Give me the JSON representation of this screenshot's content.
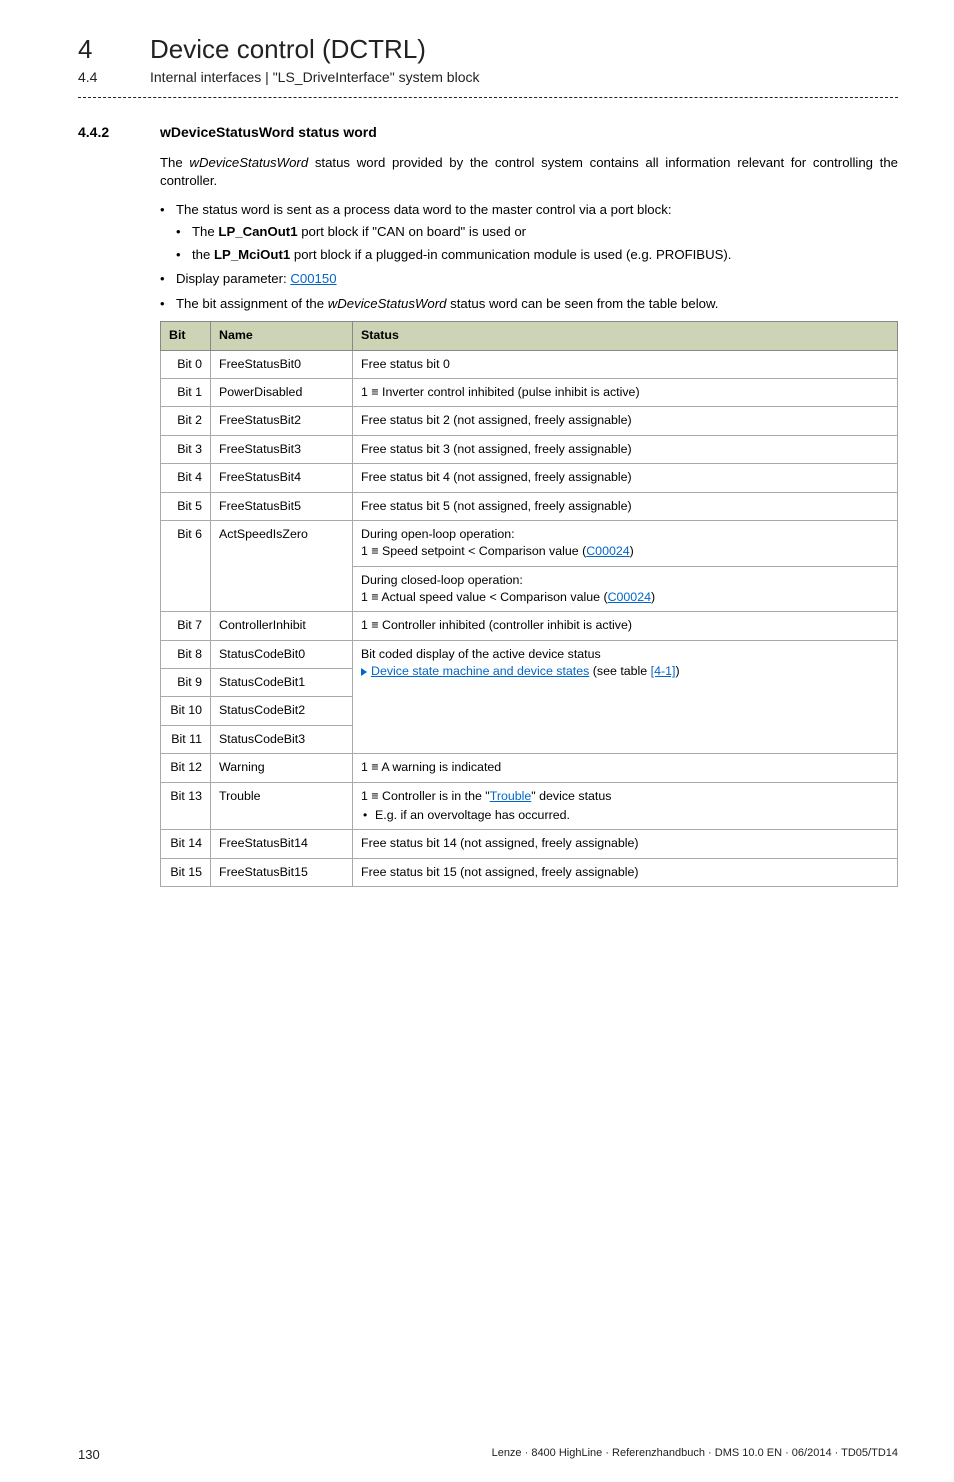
{
  "header": {
    "chapter_num": "4",
    "chapter_title": "Device control (DCTRL)",
    "sub_num": "4.4",
    "sub_title": "Internal interfaces | \"LS_DriveInterface\" system block"
  },
  "section": {
    "num": "4.4.2",
    "title": "wDeviceStatusWord status word"
  },
  "intro_a": "The ",
  "intro_italic1": "wDeviceStatusWord",
  "intro_b": " status word provided by the control system contains all information relevant for controlling the controller.",
  "b1": "The status word is sent as a process data word to the master control via a port block:",
  "b1_1a": "The ",
  "b1_1b": "LP_CanOut1",
  "b1_1c": " port block if \"CAN on board\" is used or",
  "b1_2a": "the ",
  "b1_2b": "LP_MciOut1",
  "b1_2c": " port block if a plugged-in communication module is used (e.g. PROFIBUS).",
  "b2a": "Display parameter: ",
  "b2_link": "C00150",
  "b3a": "The bit assignment of the ",
  "b3_italic": "wDeviceStatusWord",
  "b3b": " status word can be seen from the table below.",
  "th_bit": "Bit",
  "th_name": "Name",
  "th_status": "Status",
  "rows": {
    "r0": {
      "bit": "Bit 0",
      "name": "FreeStatusBit0",
      "status": "Free status bit 0"
    },
    "r1": {
      "bit": "Bit 1",
      "name": "PowerDisabled",
      "status": "1 ≡ Inverter control inhibited (pulse inhibit is active)"
    },
    "r2": {
      "bit": "Bit 2",
      "name": "FreeStatusBit2",
      "status": "Free status bit 2 (not assigned, freely assignable)"
    },
    "r3": {
      "bit": "Bit 3",
      "name": "FreeStatusBit3",
      "status": "Free status bit 3 (not assigned, freely assignable)"
    },
    "r4": {
      "bit": "Bit 4",
      "name": "FreeStatusBit4",
      "status": "Free status bit 4 (not assigned, freely assignable)"
    },
    "r5": {
      "bit": "Bit 5",
      "name": "FreeStatusBit5",
      "status": "Free status bit 5 (not assigned, freely assignable)"
    },
    "r6a": {
      "bit": "Bit 6",
      "name": "ActSpeedIsZero",
      "s1": "During open-loop operation:",
      "s2a": "1 ≡ Speed setpoint < Comparison value (",
      "s2link": "C00024",
      "s2b": ")"
    },
    "r6b": {
      "s1": "During closed-loop operation:",
      "s2a": "1 ≡ Actual speed value < Comparison value (",
      "s2link": "C00024",
      "s2b": ")"
    },
    "r7": {
      "bit": "Bit 7",
      "name": "ControllerInhibit",
      "status": "1 ≡ Controller inhibited (controller inhibit is active)"
    },
    "r8": {
      "bit": "Bit 8",
      "name": "StatusCodeBit0",
      "status": "Bit coded display of the active device status",
      "linka": "Device state machine and device states",
      "linkb": " (see table ",
      "linkc": "[4-1]",
      "linkd": ")"
    },
    "r9": {
      "bit": "Bit 9",
      "name": "StatusCodeBit1"
    },
    "r10": {
      "bit": "Bit 10",
      "name": "StatusCodeBit2"
    },
    "r11": {
      "bit": "Bit 11",
      "name": "StatusCodeBit3"
    },
    "r12": {
      "bit": "Bit 12",
      "name": "Warning",
      "status": "1 ≡ A warning is indicated"
    },
    "r13": {
      "bit": "Bit 13",
      "name": "Trouble",
      "s1a": "1 ≡ Controller is in the \"",
      "s1link": "Trouble",
      "s1b": "\" device status",
      "s2": "E.g. if an overvoltage has occurred."
    },
    "r14": {
      "bit": "Bit 14",
      "name": "FreeStatusBit14",
      "status": "Free status bit 14 (not assigned, freely assignable)"
    },
    "r15": {
      "bit": "Bit 15",
      "name": "FreeStatusBit15",
      "status": "Free status bit 15 (not assigned, freely assignable)"
    }
  },
  "footer": {
    "page": "130",
    "text": "Lenze · 8400 HighLine · Referenzhandbuch · DMS 10.0 EN · 06/2014 · TD05/TD14"
  }
}
